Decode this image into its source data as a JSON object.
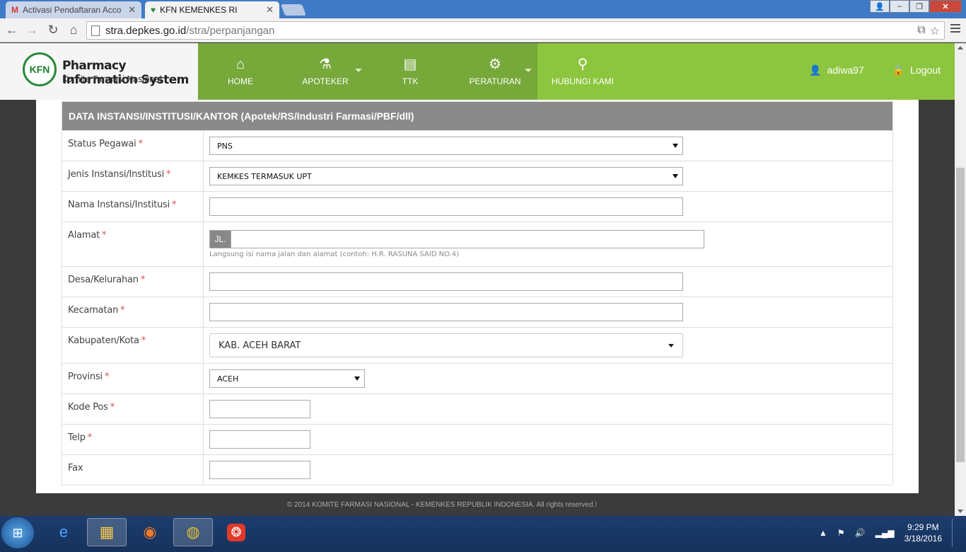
{
  "browser": {
    "tabs": [
      {
        "title": "Activasi Pendaftaran Acco",
        "icon": "gmail-icon"
      },
      {
        "title": "KFN KEMENKES RI",
        "icon": "kfn-icon"
      }
    ],
    "url_host": "stra.depkes.go.id",
    "url_path": "/stra/perpanjangan"
  },
  "site": {
    "title": "Pharmacy Information System",
    "subtitle": "Komite Farmasi Nasional",
    "logo_text": "KFN",
    "nav": [
      {
        "label": "HOME",
        "icon": "home-icon"
      },
      {
        "label": "APOTEKER",
        "icon": "flask-icon"
      },
      {
        "label": "TTK",
        "icon": "document-icon"
      },
      {
        "label": "PERATURAN",
        "icon": "gear-icon"
      },
      {
        "label": "HUBUNGI KAMI",
        "icon": "map-pin-icon"
      }
    ],
    "user": "adiwa97",
    "logout": "Logout"
  },
  "form": {
    "heading": "DATA INSTANSI/INSTITUSI/KANTOR (Apotek/RS/Industri Farmasi/PBF/dll)",
    "required_mark": "*",
    "fields": {
      "status_pegawai": {
        "label": "Status Pegawai",
        "value": "PNS"
      },
      "jenis_instansi": {
        "label": "Jenis Instansi/Institusi",
        "value": "KEMKES TERMASUK UPT"
      },
      "nama_instansi": {
        "label": "Nama Instansi/Institusi",
        "value": ""
      },
      "alamat": {
        "label": "Alamat",
        "prefix": "JL.",
        "value": "",
        "hint": "Langsung isi nama jalan dan alamat (contoh: H.R. RASUNA SAID NO.4)"
      },
      "desa": {
        "label": "Desa/Kelurahan",
        "value": ""
      },
      "kecamatan": {
        "label": "Kecamatan",
        "value": ""
      },
      "kabupaten": {
        "label": "Kabupaten/Kota",
        "value": "KAB. ACEH BARAT"
      },
      "provinsi": {
        "label": "Provinsi",
        "value": "ACEH"
      },
      "kode_pos": {
        "label": "Kode Pos",
        "value": ""
      },
      "telp": {
        "label": "Telp",
        "value": ""
      },
      "fax": {
        "label": "Fax",
        "value": ""
      }
    }
  },
  "footer": "© 2014 KOMITE FARMASI NASIONAL - KEMENKES REPUBLIK INDONESIA. All rights reserved.!",
  "taskbar": {
    "time": "9:29 PM",
    "date": "3/18/2016"
  }
}
